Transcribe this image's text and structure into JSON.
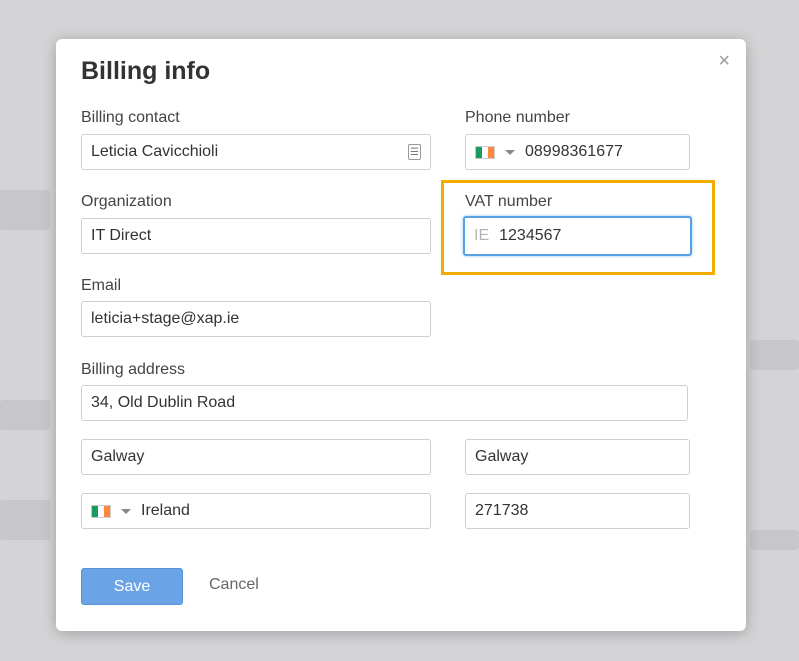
{
  "modal": {
    "title": "Billing info",
    "close_label": "×"
  },
  "form": {
    "billing_contact": {
      "label": "Billing contact",
      "value": "Leticia Cavicchioli"
    },
    "phone": {
      "label": "Phone number",
      "value": "08998361677"
    },
    "organization": {
      "label": "Organization",
      "value": "IT Direct"
    },
    "vat": {
      "label": "VAT number",
      "prefix": "IE",
      "value": "1234567"
    },
    "email": {
      "label": "Email",
      "value": "leticia+stage@xap.ie"
    },
    "address": {
      "label": "Billing address",
      "street": "34, Old Dublin Road",
      "city": "Galway",
      "county": "Galway",
      "country": "Ireland",
      "postal_code": "271738"
    }
  },
  "actions": {
    "save_label": "Save",
    "cancel_label": "Cancel"
  },
  "colors": {
    "primary_button": "#6aa4e6",
    "highlight": "#f0ad00",
    "focus_border": "#5aa0e6",
    "flag_green": "#169b62",
    "flag_white": "#ffffff",
    "flag_orange": "#ff883e"
  },
  "icons": {
    "contact": "contact-card-icon",
    "close": "close-icon",
    "flag": "ireland-flag-icon",
    "dropdown": "chevron-down-icon"
  }
}
